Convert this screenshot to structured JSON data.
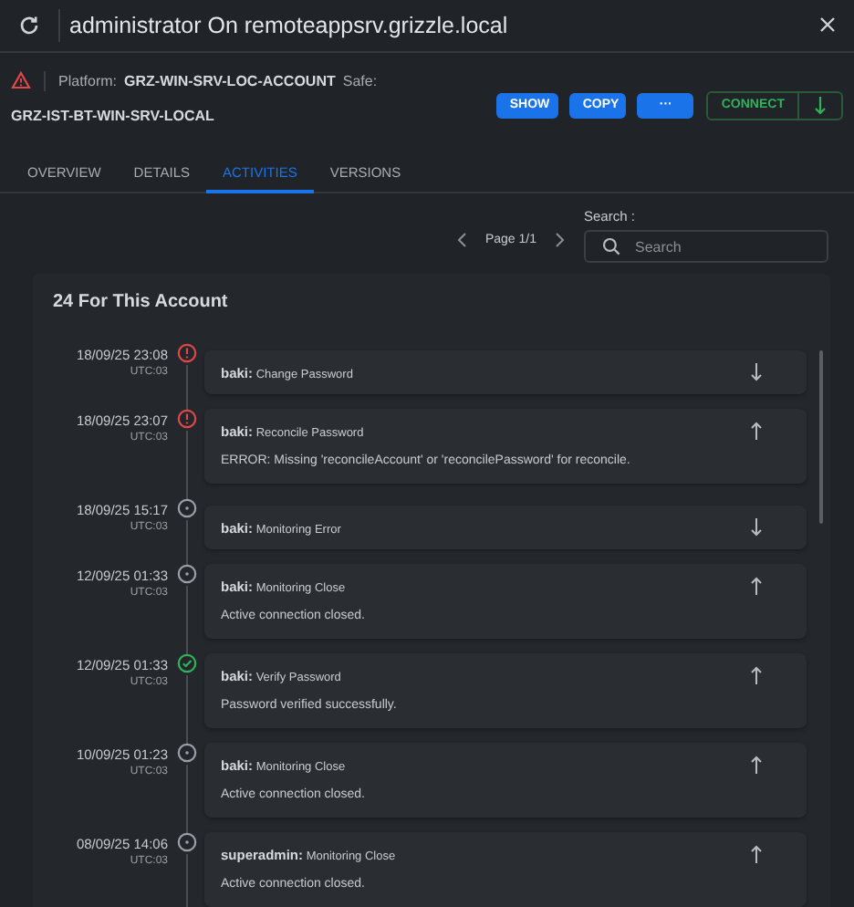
{
  "window": {
    "title": "administrator On remoteappsrv.grizzle.local"
  },
  "info": {
    "platform_label": "Platform:",
    "platform": "GRZ-WIN-SRV-LOC-ACCOUNT",
    "safe_label": "Safe:",
    "safe": "GRZ-IST-BT-WIN-SRV-LOCAL"
  },
  "actions": [
    {
      "label": "SHOW",
      "kind": "primary"
    },
    {
      "label": "COPY",
      "kind": "primary"
    },
    {
      "label": "···",
      "kind": "primary"
    },
    {
      "label": "CONNECT",
      "kind": "connect"
    }
  ],
  "tabs": [
    {
      "label": "OVERVIEW",
      "selected": false
    },
    {
      "label": "DETAILS",
      "selected": false
    },
    {
      "label": "ACTIVITIES",
      "selected": true
    },
    {
      "label": "VERSIONS",
      "selected": false
    }
  ],
  "pagination": {
    "label": "Page 1/1"
  },
  "search": {
    "label": "Search :",
    "placeholder": "Search"
  },
  "activities": {
    "title": "24 For This Account",
    "items": [
      {
        "date": "18/09/25 23:08",
        "zone": "UTC:03",
        "kind": "error",
        "user": "baki:",
        "action": "Change Password",
        "expanded": false
      },
      {
        "date": "18/09/25 23:07",
        "zone": "UTC:03",
        "kind": "error",
        "user": "baki:",
        "action": "Reconcile Password",
        "expanded": true,
        "detail": "ERROR: Missing 'reconcileAccount' or 'reconcilePassword' for reconcile."
      },
      {
        "date": "18/09/25 15:17",
        "zone": "UTC:03",
        "kind": "info",
        "user": "baki:",
        "action": "Monitoring Error",
        "expanded": false
      },
      {
        "date": "12/09/25 01:33",
        "zone": "UTC:03",
        "kind": "info",
        "user": "baki:",
        "action": "Monitoring Close",
        "expanded": true,
        "detail": "Active connection closed."
      },
      {
        "date": "12/09/25 01:33",
        "zone": "UTC:03",
        "kind": "success",
        "user": "baki:",
        "action": "Verify Password",
        "expanded": true,
        "detail": "Password verified successfully."
      },
      {
        "date": "10/09/25 01:23",
        "zone": "UTC:03",
        "kind": "info",
        "user": "baki:",
        "action": "Monitoring Close",
        "expanded": true,
        "detail": "Active connection closed."
      },
      {
        "date": "08/09/25 14:06",
        "zone": "UTC:03",
        "kind": "info",
        "user": "superadmin:",
        "action": "Monitoring Close",
        "expanded": true,
        "detail": "Active connection closed."
      }
    ]
  }
}
